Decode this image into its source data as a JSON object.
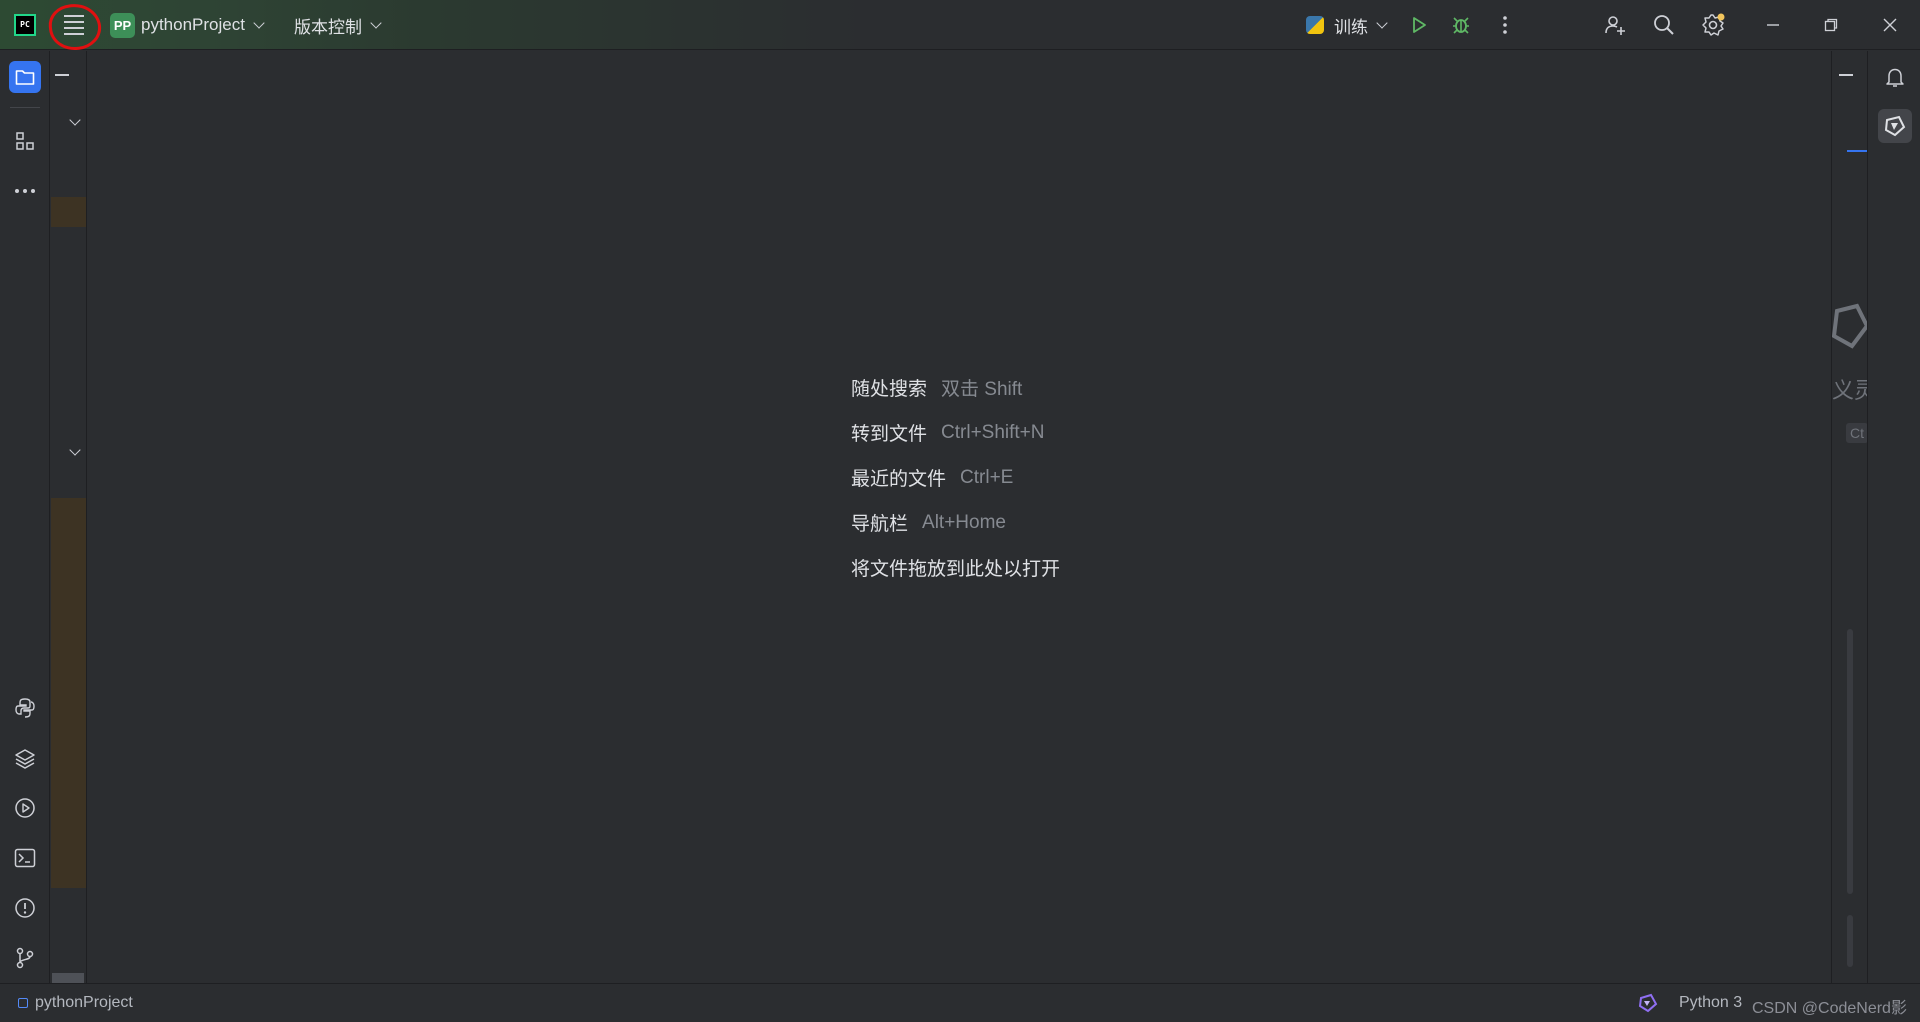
{
  "titlebar": {
    "logo_text": "PC",
    "project_badge": "PP",
    "project_name": "pythonProject",
    "vcs_label": "版本控制",
    "run_config": "训练"
  },
  "icons": {
    "main_menu": "hamburger-menu-icon",
    "run": "play-icon",
    "debug": "bug-icon",
    "more": "more-vertical-icon",
    "add_user": "add-user-icon",
    "search": "search-icon",
    "settings": "gear-icon",
    "minimize": "minimize-icon",
    "restore": "restore-icon",
    "close": "close-icon",
    "project": "folder-icon",
    "structure": "structure-icon",
    "more_tools": "more-horizontal-icon",
    "python_console": "python-icon",
    "services": "layers-icon",
    "run_tool": "run-circle-icon",
    "terminal": "terminal-icon",
    "problems": "warning-circle-icon",
    "git": "git-branch-icon",
    "notifications": "bell-icon",
    "ai_assistant": "ai-assistant-icon"
  },
  "editor": {
    "hints": [
      {
        "label": "随处搜索",
        "key": "双击 Shift"
      },
      {
        "label": "转到文件",
        "key": "Ctrl+Shift+N"
      },
      {
        "label": "最近的文件",
        "key": "Ctrl+E"
      },
      {
        "label": "导航栏",
        "key": "Alt+Home"
      },
      {
        "label": "将文件拖放到此处以打开",
        "key": ""
      }
    ]
  },
  "right_panel": {
    "partial_text_1": "义灵",
    "partial_text_2": "Ct"
  },
  "statusbar": {
    "project": "pythonProject",
    "interpreter": "Python 3",
    "watermark": "CSDN @CodeNerd影"
  },
  "colors": {
    "accent": "#3574f0",
    "run_green": "#5fb865",
    "highlight_circle": "#e01010",
    "settings_badge": "#f2c55c"
  }
}
